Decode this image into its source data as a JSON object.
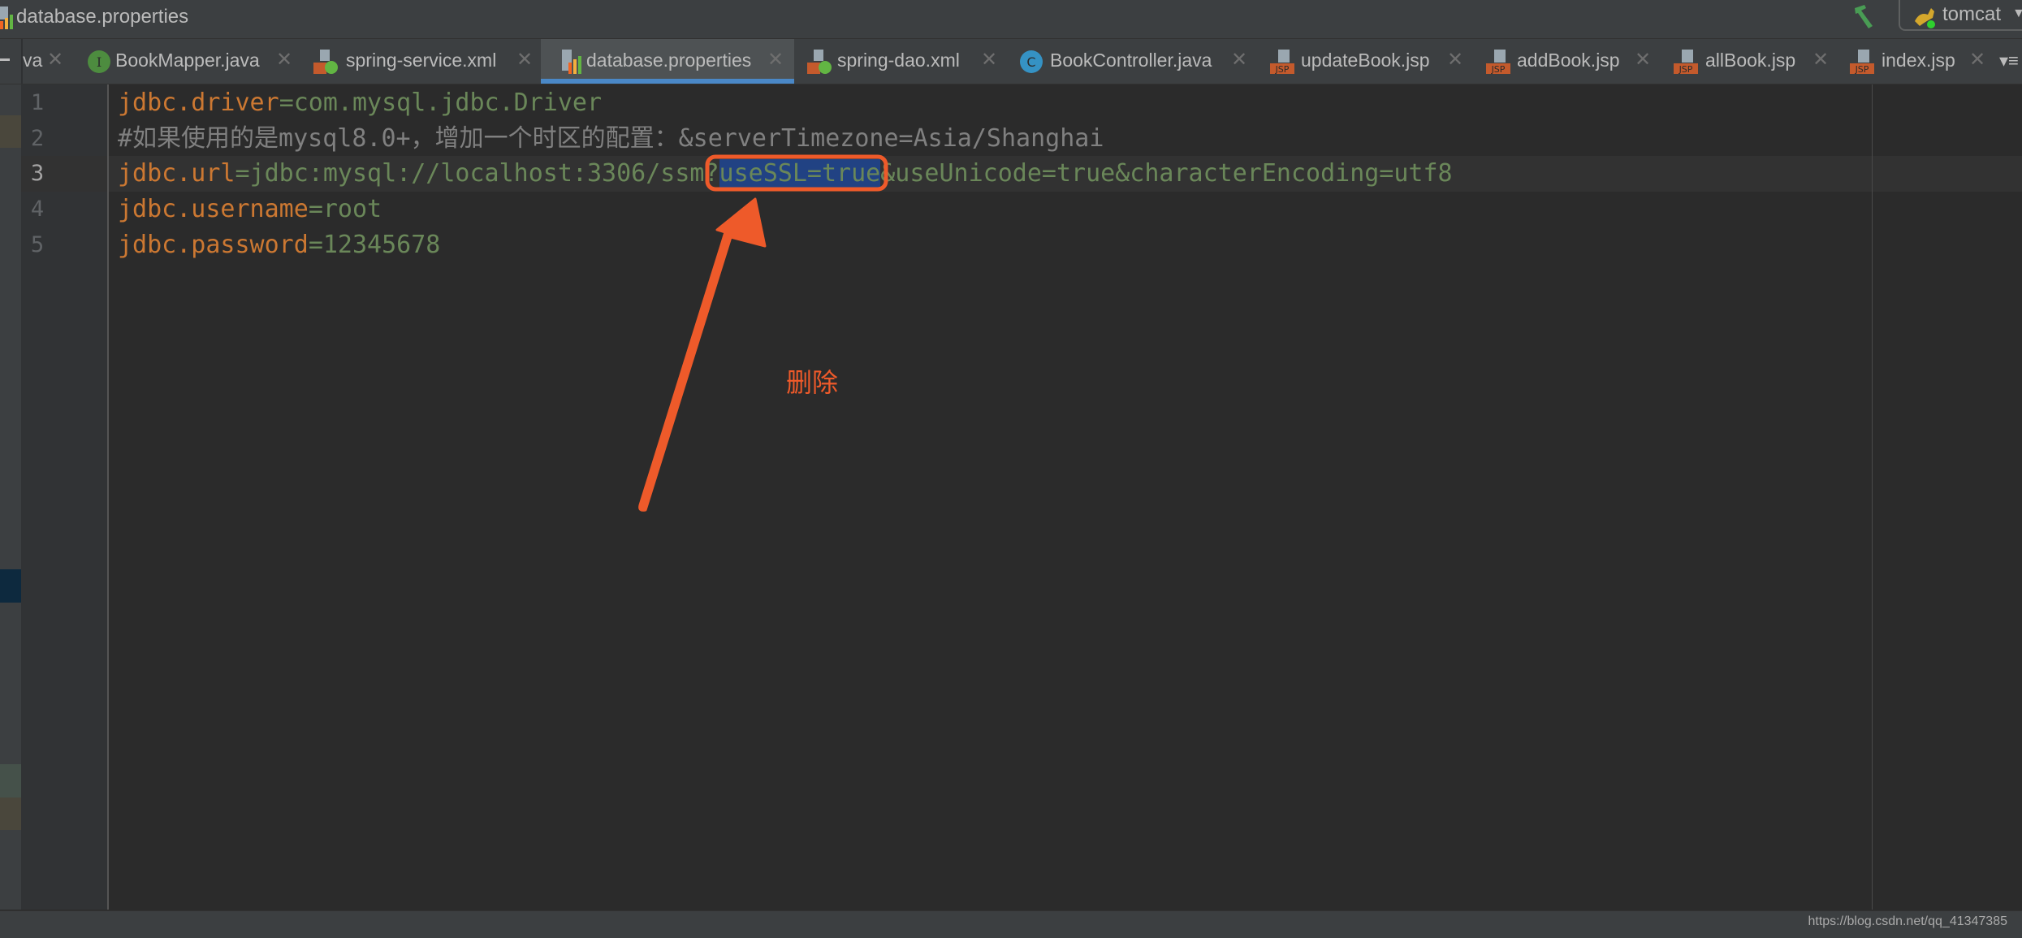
{
  "titlebar": {
    "breadcrumb": "database.properties",
    "run_config": "tomcat"
  },
  "tabs": [
    {
      "label": "va",
      "icon": "java-file-icon",
      "partial": true
    },
    {
      "label": "BookMapper.java",
      "icon": "interface-icon"
    },
    {
      "label": "spring-service.xml",
      "icon": "spring-xml-icon"
    },
    {
      "label": "database.properties",
      "icon": "properties-icon",
      "active": true
    },
    {
      "label": "spring-dao.xml",
      "icon": "spring-xml-icon"
    },
    {
      "label": "BookController.java",
      "icon": "class-icon"
    },
    {
      "label": "updateBook.jsp",
      "icon": "jsp-icon"
    },
    {
      "label": "addBook.jsp",
      "icon": "jsp-icon"
    },
    {
      "label": "allBook.jsp",
      "icon": "jsp-icon"
    },
    {
      "label": "index.jsp",
      "icon": "jsp-icon"
    }
  ],
  "close_glyph": "✕",
  "editor": {
    "current_line": 3,
    "lines": [
      {
        "number": "1",
        "key": "jdbc.driver",
        "eq": "=",
        "value": "com.mysql.jdbc.Driver"
      },
      {
        "number": "2",
        "comment": "#如果使用的是mysql8.0+，增加一个时区的配置：&serverTimezone=Asia/Shanghai"
      },
      {
        "number": "3",
        "key": "jdbc.url",
        "eq": "=",
        "value_before": "jdbc:mysql://localhost:3306/ssm?",
        "selected": "useSSL=true",
        "value_after": "&useUnicode=true&characterEncoding=utf8"
      },
      {
        "number": "4",
        "key": "jdbc.username",
        "eq": "=",
        "value": "root"
      },
      {
        "number": "5",
        "key": "jdbc.password",
        "eq": "=",
        "value": "12345678"
      }
    ]
  },
  "annotation": {
    "label": "删除",
    "color": "#ee5a2a"
  },
  "statusbar": {
    "watermark": "https://blog.csdn.net/qq_41347385"
  },
  "colors": {
    "accent_tab_underline": "#4a88c7",
    "key": "#cc7832",
    "value": "#6a8759",
    "comment": "#808080",
    "selection": "#214283"
  }
}
